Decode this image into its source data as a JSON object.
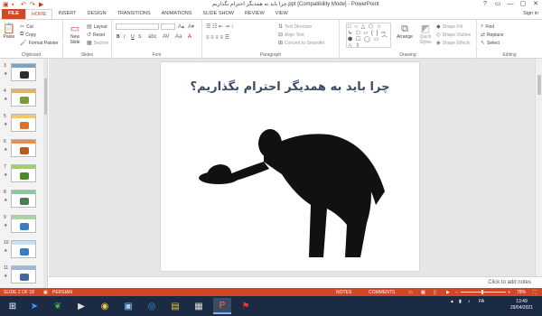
{
  "window": {
    "title": "چرا باید به همدیگر احترام بگذاریم.ppt [Compatibility Mode] - PowerPoint",
    "controls": [
      "?",
      "▭",
      "—",
      "▢",
      "✕"
    ]
  },
  "tabs": {
    "file": "FILE",
    "items": [
      "HOME",
      "INSERT",
      "DESIGN",
      "TRANSITIONS",
      "ANIMATIONS",
      "SLIDE SHOW",
      "REVIEW",
      "VIEW"
    ],
    "active_index": 0,
    "sign_in": "Sign in"
  },
  "ribbon": {
    "clipboard": {
      "paste": "Paste",
      "cut": "Cut",
      "copy": "Copy",
      "format_painter": "Format Painter",
      "label": "Clipboard"
    },
    "slides": {
      "new_slide": "New Slide",
      "layout": "Layout",
      "reset": "Reset",
      "section": "Section",
      "label": "Slides"
    },
    "font": {
      "bold": "B",
      "italic": "I",
      "underline": "U",
      "strike": "S",
      "label": "Font"
    },
    "paragraph": {
      "text_direction": "Text Direction",
      "align_text": "Align Text",
      "convert_smartart": "Convert to SmartArt",
      "label": "Paragraph"
    },
    "drawing": {
      "shapes": "□ ○ △ ⬠ ☆ ↳ ⬡ ▱ { } ⇨ ⬢ ☐ ◯ ▭ ⌒ △ ⇧",
      "arrange": "Arrange",
      "quick_styles": "Quick Styles",
      "shape_fill": "Shape Fill",
      "shape_outline": "Shape Outline",
      "shape_effects": "Shape Effects",
      "label": "Drawing"
    },
    "editing": {
      "find": "Find",
      "replace": "Replace",
      "select": "Select",
      "label": "Editing"
    }
  },
  "thumbnails": [
    {
      "num": "3",
      "stripe": "#7aa3c9",
      "blob": "#2d2d2d"
    },
    {
      "num": "4",
      "stripe": "#e3b36b",
      "blob": "#7c9a3a"
    },
    {
      "num": "5",
      "stripe": "#f0c96a",
      "blob": "#d9732a"
    },
    {
      "num": "6",
      "stripe": "#e4904a",
      "blob": "#bb5a20"
    },
    {
      "num": "7",
      "stripe": "#9fcf6a",
      "blob": "#4e8a2a"
    },
    {
      "num": "8",
      "stripe": "#8bc7a0",
      "blob": "#4b7b54"
    },
    {
      "num": "9",
      "stripe": "#a8d6a2",
      "blob": "#3b7ebf"
    },
    {
      "num": "10",
      "stripe": "#c9dff3",
      "blob": "#3b7ebf"
    },
    {
      "num": "11",
      "stripe": "#9fb6d6",
      "blob": "#44699a"
    }
  ],
  "slide": {
    "title": "چرا باید به همدیگر احترام بگذاریم؟"
  },
  "notes": {
    "placeholder": "Click to add notes"
  },
  "status": {
    "slide_of": "SLIDE 2 OF 18",
    "language": "PERSIAN",
    "notes_btn": "NOTES",
    "comments_btn": "COMMENTS",
    "zoom": "78%",
    "zoom_level": 0.46
  },
  "taskbar": {
    "time": "13:49",
    "date": "29/04/2021",
    "lang": "FA",
    "accent": "#7fb2ff"
  },
  "colors": {
    "brand": "#d24726",
    "title_text": "#3a4a68"
  }
}
